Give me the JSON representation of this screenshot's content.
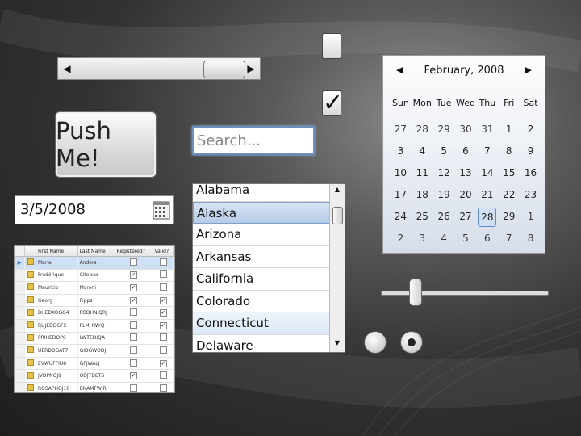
{
  "scrollbar": {
    "value_fraction": 0.78
  },
  "push_button": {
    "label": "Push Me!"
  },
  "search": {
    "placeholder": "Search..."
  },
  "checkboxes": [
    {
      "checked": false
    },
    {
      "checked": true,
      "glyph": "✓"
    }
  ],
  "date_picker": {
    "value": "3/5/2008",
    "icon": "calendar-icon"
  },
  "states_list": {
    "items": [
      "Alabama",
      "Alaska",
      "Arizona",
      "Arkansas",
      "California",
      "Colorado",
      "Connecticut",
      "Delaware"
    ],
    "selected": "Alaska",
    "hover": "Connecticut"
  },
  "grid": {
    "columns": [
      "First Name",
      "Last Name",
      "Registered?",
      "Valid?"
    ],
    "rows": [
      {
        "first": "Maria",
        "last": "Anders",
        "registered": false,
        "valid": false
      },
      {
        "first": "Frédérique",
        "last": "Citeaux",
        "registered": true,
        "valid": false
      },
      {
        "first": "Mauricio",
        "last": "Moroni",
        "registered": true,
        "valid": false
      },
      {
        "first": "Georg",
        "last": "Pipps",
        "registered": true,
        "valid": true
      },
      {
        "first": "BHEDXOGQ4",
        "last": "PODHNIQRJ",
        "registered": false,
        "valid": true
      },
      {
        "first": "RUJEDDGF5",
        "last": "PLMHWYQ",
        "registered": false,
        "valid": true
      },
      {
        "first": "PRIHEDOP6",
        "last": "LWTEDIQA",
        "registered": false,
        "valid": false
      },
      {
        "first": "UERDDGAT7",
        "last": "GIDGWODJ",
        "registered": false,
        "valid": false
      },
      {
        "first": "EVWUFFIU8",
        "last": "GPJWALJ",
        "registered": false,
        "valid": true
      },
      {
        "first": "JVDPNOJ9",
        "last": "ODJTDETS",
        "registered": true,
        "valid": false
      },
      {
        "first": "ROSAPHOJ10",
        "last": "BNAMFWJR",
        "registered": false,
        "valid": false
      }
    ],
    "selected_row": 0
  },
  "calendar": {
    "title": "February, 2008",
    "prev_glyph": "◀",
    "next_glyph": "▶",
    "weekdays": [
      "Sun",
      "Mon",
      "Tue",
      "Wed",
      "Thu",
      "Fri",
      "Sat"
    ],
    "days": [
      {
        "d": "27",
        "m": true
      },
      {
        "d": "28",
        "m": true
      },
      {
        "d": "29",
        "m": true
      },
      {
        "d": "30",
        "m": true
      },
      {
        "d": "31",
        "m": true
      },
      {
        "d": "1"
      },
      {
        "d": "2"
      },
      {
        "d": "3"
      },
      {
        "d": "4"
      },
      {
        "d": "5"
      },
      {
        "d": "6"
      },
      {
        "d": "7"
      },
      {
        "d": "8"
      },
      {
        "d": "9"
      },
      {
        "d": "10"
      },
      {
        "d": "11"
      },
      {
        "d": "12"
      },
      {
        "d": "13"
      },
      {
        "d": "14"
      },
      {
        "d": "15"
      },
      {
        "d": "16"
      },
      {
        "d": "17"
      },
      {
        "d": "18"
      },
      {
        "d": "19"
      },
      {
        "d": "20"
      },
      {
        "d": "21"
      },
      {
        "d": "22"
      },
      {
        "d": "23"
      },
      {
        "d": "24"
      },
      {
        "d": "25"
      },
      {
        "d": "26"
      },
      {
        "d": "27"
      },
      {
        "d": "28",
        "today": true
      },
      {
        "d": "29"
      },
      {
        "d": "1",
        "m": true
      },
      {
        "d": "2",
        "m": true
      },
      {
        "d": "3",
        "m": true
      },
      {
        "d": "4",
        "m": true
      },
      {
        "d": "5",
        "m": true
      },
      {
        "d": "6",
        "m": true
      },
      {
        "d": "7",
        "m": true
      },
      {
        "d": "8",
        "m": true
      }
    ]
  },
  "slider": {
    "value_fraction": 0.2
  },
  "radios": [
    {
      "checked": false
    },
    {
      "checked": true
    }
  ]
}
